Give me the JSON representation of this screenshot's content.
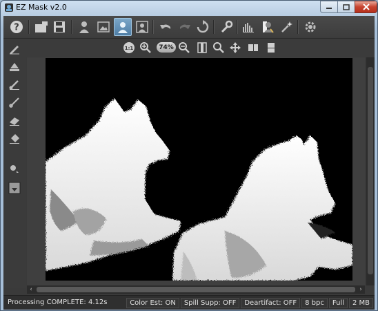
{
  "window": {
    "title": "EZ Mask v2.0"
  },
  "toolbar": {
    "help": "?",
    "zoom_level": "74%",
    "actual_size": "1:1"
  },
  "status": {
    "message": "Processing COMPLETE: 4.12s",
    "segments": [
      "Color Est: ON",
      "Spill Supp: OFF",
      "Deartifact: OFF",
      "8 bpc",
      "Full",
      "2 MB"
    ]
  },
  "scroll": {
    "left": "‹",
    "right": "›"
  },
  "colors": {
    "accent": "#5b8db8",
    "background": "#3a3a3a",
    "canvas": "#000000"
  }
}
